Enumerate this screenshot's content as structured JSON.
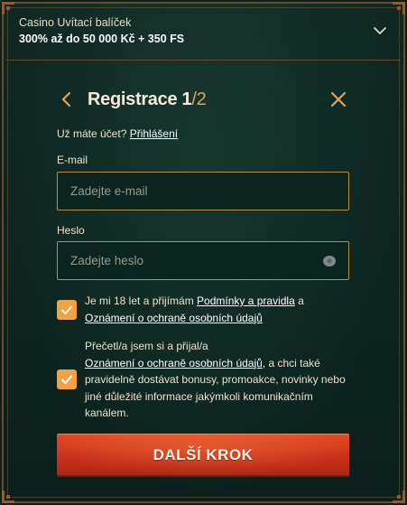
{
  "promo": {
    "title": "Casino Uvítací balíček",
    "subtitle": "300% až do 50 000 Kč + 350 FS",
    "chevron_icon": "chevron-down-icon"
  },
  "header": {
    "title": "Registrace 1",
    "step_total": "/2",
    "back_icon": "chevron-left-icon",
    "close_icon": "close-icon"
  },
  "account": {
    "question": "Už máte účet?",
    "login_link": "Přihlášení"
  },
  "email": {
    "label": "E-mail",
    "placeholder": "Zadejte e-mail",
    "value": ""
  },
  "password": {
    "label": "Heslo",
    "placeholder": "Zadejte heslo",
    "value": "",
    "eye_icon": "eye-icon"
  },
  "consent_age": {
    "checked": true,
    "text_before": "Je mi 18 let a přijímám ",
    "link_terms": "Podmínky a pravidla",
    "text_mid": " a",
    "link_privacy": "Oznámení o ochraně osobních údajů"
  },
  "consent_marketing": {
    "checked": true,
    "text_before": "Přečetl/a jsem si a přijal/a",
    "link_privacy": "Oznámení o ochraně osobních údajů",
    "text_after": ", a chci také pravidelně dostávat bonusy, promoakce, novinky nebo jiné důležité informace jakýmkoli komunikačním kanálem."
  },
  "submit": {
    "label": "DALŠÍ KROK"
  },
  "colors": {
    "background": "#0c1f1b",
    "border": "#b98d54",
    "accent_orange": "#f2a241",
    "button_red": "#c8321b"
  }
}
